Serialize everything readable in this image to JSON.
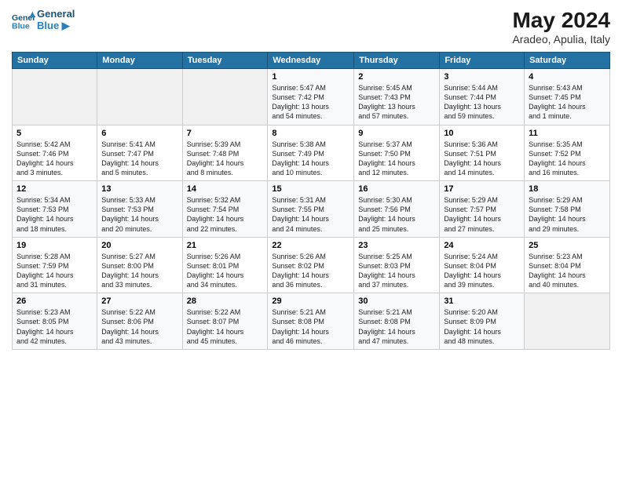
{
  "header": {
    "title": "May 2024",
    "location": "Aradeo, Apulia, Italy"
  },
  "columns": [
    "Sunday",
    "Monday",
    "Tuesday",
    "Wednesday",
    "Thursday",
    "Friday",
    "Saturday"
  ],
  "weeks": [
    [
      {
        "day": "",
        "info": ""
      },
      {
        "day": "",
        "info": ""
      },
      {
        "day": "",
        "info": ""
      },
      {
        "day": "1",
        "info": "Sunrise: 5:47 AM\nSunset: 7:42 PM\nDaylight: 13 hours\nand 54 minutes."
      },
      {
        "day": "2",
        "info": "Sunrise: 5:45 AM\nSunset: 7:43 PM\nDaylight: 13 hours\nand 57 minutes."
      },
      {
        "day": "3",
        "info": "Sunrise: 5:44 AM\nSunset: 7:44 PM\nDaylight: 13 hours\nand 59 minutes."
      },
      {
        "day": "4",
        "info": "Sunrise: 5:43 AM\nSunset: 7:45 PM\nDaylight: 14 hours\nand 1 minute."
      }
    ],
    [
      {
        "day": "5",
        "info": "Sunrise: 5:42 AM\nSunset: 7:46 PM\nDaylight: 14 hours\nand 3 minutes."
      },
      {
        "day": "6",
        "info": "Sunrise: 5:41 AM\nSunset: 7:47 PM\nDaylight: 14 hours\nand 5 minutes."
      },
      {
        "day": "7",
        "info": "Sunrise: 5:39 AM\nSunset: 7:48 PM\nDaylight: 14 hours\nand 8 minutes."
      },
      {
        "day": "8",
        "info": "Sunrise: 5:38 AM\nSunset: 7:49 PM\nDaylight: 14 hours\nand 10 minutes."
      },
      {
        "day": "9",
        "info": "Sunrise: 5:37 AM\nSunset: 7:50 PM\nDaylight: 14 hours\nand 12 minutes."
      },
      {
        "day": "10",
        "info": "Sunrise: 5:36 AM\nSunset: 7:51 PM\nDaylight: 14 hours\nand 14 minutes."
      },
      {
        "day": "11",
        "info": "Sunrise: 5:35 AM\nSunset: 7:52 PM\nDaylight: 14 hours\nand 16 minutes."
      }
    ],
    [
      {
        "day": "12",
        "info": "Sunrise: 5:34 AM\nSunset: 7:53 PM\nDaylight: 14 hours\nand 18 minutes."
      },
      {
        "day": "13",
        "info": "Sunrise: 5:33 AM\nSunset: 7:53 PM\nDaylight: 14 hours\nand 20 minutes."
      },
      {
        "day": "14",
        "info": "Sunrise: 5:32 AM\nSunset: 7:54 PM\nDaylight: 14 hours\nand 22 minutes."
      },
      {
        "day": "15",
        "info": "Sunrise: 5:31 AM\nSunset: 7:55 PM\nDaylight: 14 hours\nand 24 minutes."
      },
      {
        "day": "16",
        "info": "Sunrise: 5:30 AM\nSunset: 7:56 PM\nDaylight: 14 hours\nand 25 minutes."
      },
      {
        "day": "17",
        "info": "Sunrise: 5:29 AM\nSunset: 7:57 PM\nDaylight: 14 hours\nand 27 minutes."
      },
      {
        "day": "18",
        "info": "Sunrise: 5:29 AM\nSunset: 7:58 PM\nDaylight: 14 hours\nand 29 minutes."
      }
    ],
    [
      {
        "day": "19",
        "info": "Sunrise: 5:28 AM\nSunset: 7:59 PM\nDaylight: 14 hours\nand 31 minutes."
      },
      {
        "day": "20",
        "info": "Sunrise: 5:27 AM\nSunset: 8:00 PM\nDaylight: 14 hours\nand 33 minutes."
      },
      {
        "day": "21",
        "info": "Sunrise: 5:26 AM\nSunset: 8:01 PM\nDaylight: 14 hours\nand 34 minutes."
      },
      {
        "day": "22",
        "info": "Sunrise: 5:26 AM\nSunset: 8:02 PM\nDaylight: 14 hours\nand 36 minutes."
      },
      {
        "day": "23",
        "info": "Sunrise: 5:25 AM\nSunset: 8:03 PM\nDaylight: 14 hours\nand 37 minutes."
      },
      {
        "day": "24",
        "info": "Sunrise: 5:24 AM\nSunset: 8:04 PM\nDaylight: 14 hours\nand 39 minutes."
      },
      {
        "day": "25",
        "info": "Sunrise: 5:23 AM\nSunset: 8:04 PM\nDaylight: 14 hours\nand 40 minutes."
      }
    ],
    [
      {
        "day": "26",
        "info": "Sunrise: 5:23 AM\nSunset: 8:05 PM\nDaylight: 14 hours\nand 42 minutes."
      },
      {
        "day": "27",
        "info": "Sunrise: 5:22 AM\nSunset: 8:06 PM\nDaylight: 14 hours\nand 43 minutes."
      },
      {
        "day": "28",
        "info": "Sunrise: 5:22 AM\nSunset: 8:07 PM\nDaylight: 14 hours\nand 45 minutes."
      },
      {
        "day": "29",
        "info": "Sunrise: 5:21 AM\nSunset: 8:08 PM\nDaylight: 14 hours\nand 46 minutes."
      },
      {
        "day": "30",
        "info": "Sunrise: 5:21 AM\nSunset: 8:08 PM\nDaylight: 14 hours\nand 47 minutes."
      },
      {
        "day": "31",
        "info": "Sunrise: 5:20 AM\nSunset: 8:09 PM\nDaylight: 14 hours\nand 48 minutes."
      },
      {
        "day": "",
        "info": ""
      }
    ]
  ]
}
